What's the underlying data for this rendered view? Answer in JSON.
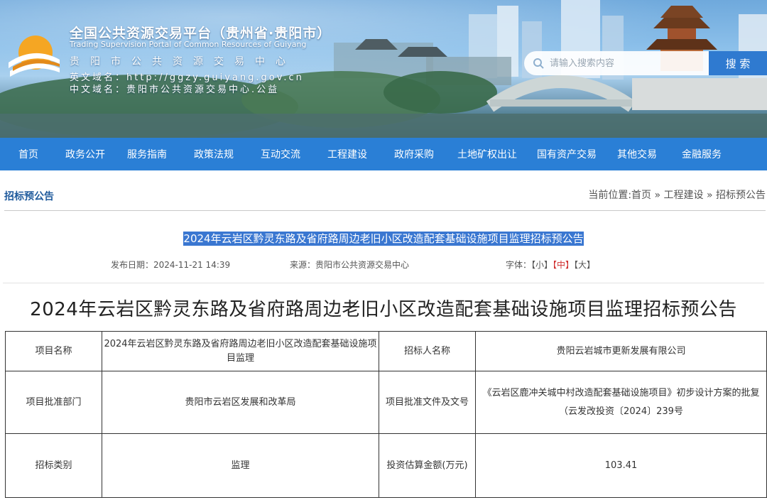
{
  "header": {
    "title_cn": "全国公共资源交易平台（贵州省·贵阳市）",
    "title_en": "Trading Supervision Portal of Common Resources of Guiyang",
    "title_sub": "贵阳市公共资源交易中心",
    "domain_en": "英文域名：http://ggzy.guiyang.gov.cn",
    "domain_cn": "中文域名：贵阳市公共资源交易中心.公益",
    "search_placeholder": "请输入搜索内容",
    "search_button": "搜 索"
  },
  "nav": {
    "items": [
      "首页",
      "政务公开",
      "服务指南",
      "政策法规",
      "互动交流",
      "工程建设",
      "政府采购",
      "土地矿权出让",
      "国有资产交易",
      "其他交易",
      "金融服务"
    ]
  },
  "crumb": {
    "section_title": "招标预公告",
    "breadcrumb": "当前位置:首页 » 工程建设 » 招标预公告"
  },
  "article": {
    "link_title": "2024年云岩区黔灵东路及省府路周边老旧小区改造配套基础设施项目监理招标预公告",
    "publish_date": "发布日期：2024-11-21 14:39",
    "source": "来源：贵阳市公共资源交易中心",
    "font_label": "字体：",
    "font_small": "【小】",
    "font_medium": "【中】",
    "font_large": "【大】",
    "main_title": "2024年云岩区黔灵东路及省府路周边老旧小区改造配套基础设施项目监理招标预公告"
  },
  "table": {
    "rows": [
      [
        "项目名称",
        "2024年云岩区黔灵东路及省府路周边老旧小区改造配套基础设施项目监理",
        "招标人名称",
        "贵阳云岩城市更新发展有限公司"
      ],
      [
        "项目批准部门",
        "贵阳市云岩区发展和改革局",
        "项目批准文件及文号",
        "《云岩区鹿冲关城中村改造配套基础设施项目》初步设计方案的批复（云发改投资〔2024〕239号"
      ],
      [
        "招标类别",
        "监理",
        "投资估算金额(万元)",
        "103.41"
      ]
    ]
  },
  "colors": {
    "nav_bg": "#2a7fd6",
    "section_title": "#1f5a9c",
    "highlight_bg": "#3a77d1",
    "font_selected": "#d03030"
  }
}
